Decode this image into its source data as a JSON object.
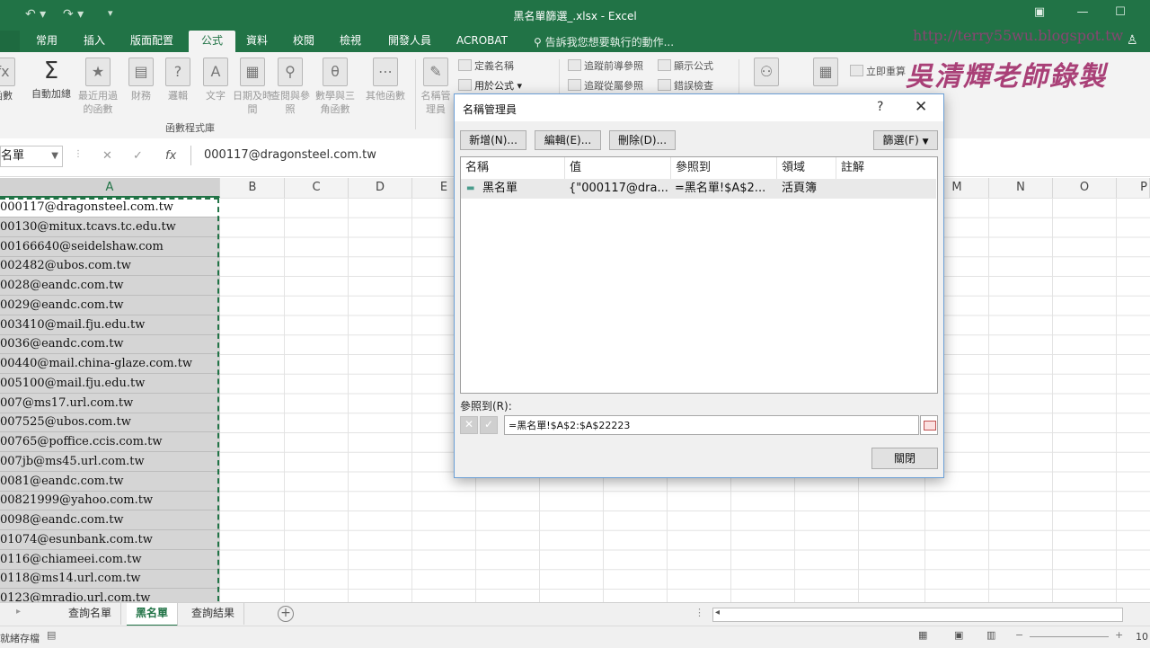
{
  "window": {
    "title": "黑名單篩選_.xlsx - Excel"
  },
  "tabs": [
    {
      "label": "常用"
    },
    {
      "label": "插入"
    },
    {
      "label": "版面配置"
    },
    {
      "label": "公式",
      "active": true
    },
    {
      "label": "資料"
    },
    {
      "label": "校閱"
    },
    {
      "label": "檢視"
    },
    {
      "label": "開發人員"
    },
    {
      "label": "ACROBAT"
    }
  ],
  "tell_me": "告訴我您想要執行的動作...",
  "ribbon": {
    "autosum": "自動加總",
    "recent": "最近用過的函數",
    "financial": "財務",
    "logical": "邏輯",
    "text": "文字",
    "datetime": "日期及時間",
    "lookup": "查閱與參照",
    "math": "數學與三角函數",
    "more": "其他函數",
    "name_mgr": "名稱管理員",
    "define_name": "定義名稱",
    "use_in_formula": "用於公式",
    "trace_prec": "追蹤前導參照",
    "trace_dep": "追蹤從屬參照",
    "show_formulas": "顯示公式",
    "error_check": "錯誤檢查",
    "calc_now": "立即重算",
    "group_label": "函數程式庫",
    "fx_partial": "函數"
  },
  "formula_bar": {
    "name_box": "名單",
    "content": "000117@dragonsteel.com.tw"
  },
  "columns": [
    "A",
    "B",
    "C",
    "D",
    "E",
    "M",
    "N",
    "O",
    "P"
  ],
  "cells": [
    "000117@dragonsteel.com.tw",
    "00130@mitux.tcavs.tc.edu.tw",
    "00166640@seidelshaw.com",
    "002482@ubos.com.tw",
    "0028@eandc.com.tw",
    "0029@eandc.com.tw",
    "003410@mail.fju.edu.tw",
    "0036@eandc.com.tw",
    "00440@mail.china-glaze.com.tw",
    "005100@mail.fju.edu.tw",
    "007@ms17.url.com.tw",
    "007525@ubos.com.tw",
    "00765@poffice.ccis.com.tw",
    "007jb@ms45.url.com.tw",
    "0081@eandc.com.tw",
    "00821999@yahoo.com.tw",
    "0098@eandc.com.tw",
    "01074@esunbank.com.tw",
    "0116@chiameei.com.tw",
    "0118@ms14.url.com.tw",
    "0123@mradio.url.com.tw"
  ],
  "sheets": [
    {
      "label": "查詢名單"
    },
    {
      "label": "黑名單",
      "active": true
    },
    {
      "label": "查詢結果"
    }
  ],
  "status": {
    "text": "就緒存檔",
    "zoom": "10"
  },
  "watermark": {
    "url": "http://terry55wu.blogspot.tw",
    "sign": "吳清輝老師錄製"
  },
  "dialog": {
    "title": "名稱管理員",
    "help": "?",
    "buttons": {
      "new": "新增(N)...",
      "edit": "編輯(E)...",
      "delete": "刪除(D)...",
      "filter": "篩選(F)",
      "close": "關閉"
    },
    "headers": {
      "name": "名稱",
      "value": "值",
      "refers_to": "參照到",
      "scope": "領域",
      "comment": "註解"
    },
    "rows": [
      {
        "name": "黑名單",
        "value": "{\"000117@dra...",
        "refers_to": "=黑名單!$A$2...",
        "scope": "活頁簿",
        "comment": ""
      }
    ],
    "refers_label": "參照到(R):",
    "refers_value": "=黑名單!$A$2:$A$22223"
  }
}
